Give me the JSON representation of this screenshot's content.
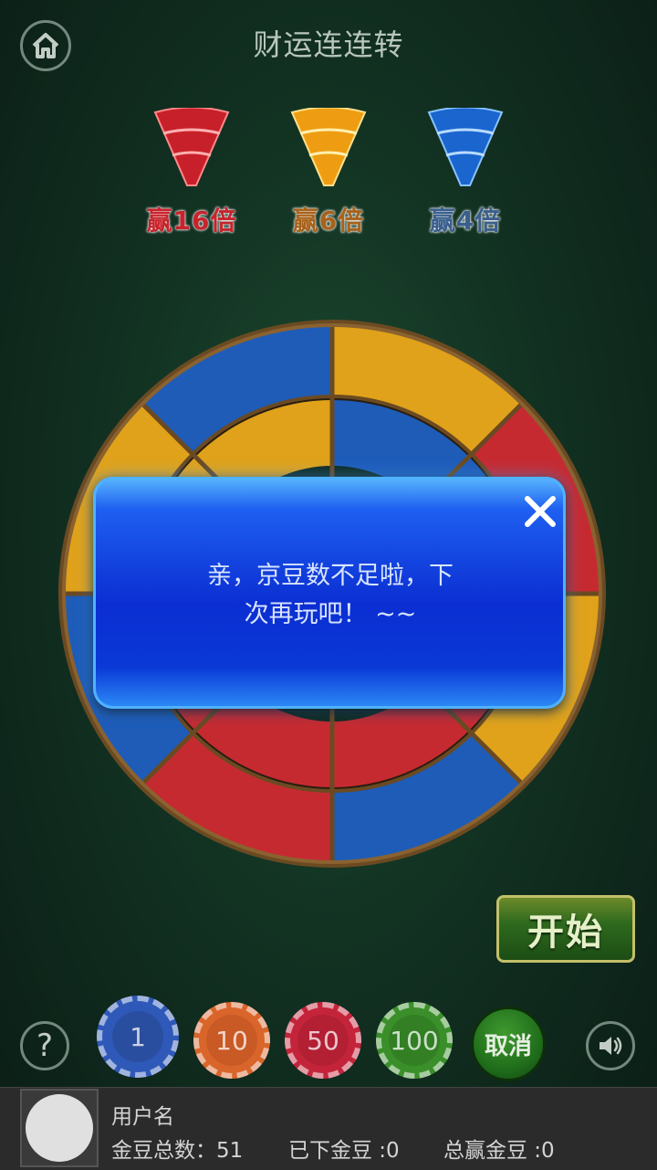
{
  "header": {
    "title": "财运连连转",
    "home_icon": "home-icon"
  },
  "legend": [
    {
      "label": "赢16倍",
      "color": "#d2262c"
    },
    {
      "label": "赢6倍",
      "color": "#f2a413"
    },
    {
      "label": "赢4倍",
      "color": "#1b6fd6"
    }
  ],
  "dialog": {
    "message_line1": "亲，京豆数不足啦，下",
    "message_line2": "次再玩吧！ ~~",
    "close_icon": "close-icon"
  },
  "start_button": {
    "label": "开始"
  },
  "chips": [
    {
      "label": "1",
      "color": "#2f59b8"
    },
    {
      "label": "10",
      "color": "#d9652a"
    },
    {
      "label": "50",
      "color": "#c4243a"
    },
    {
      "label": "100",
      "color": "#3a8f2a"
    }
  ],
  "cancel_button": {
    "label": "取消"
  },
  "help_icon": "help-icon",
  "sound_icon": "speaker-icon",
  "user": {
    "name": "用户名",
    "total_label": "金豆总数：51",
    "bet_label": "已下金豆 :0",
    "won_label": "总赢金豆 :0"
  }
}
